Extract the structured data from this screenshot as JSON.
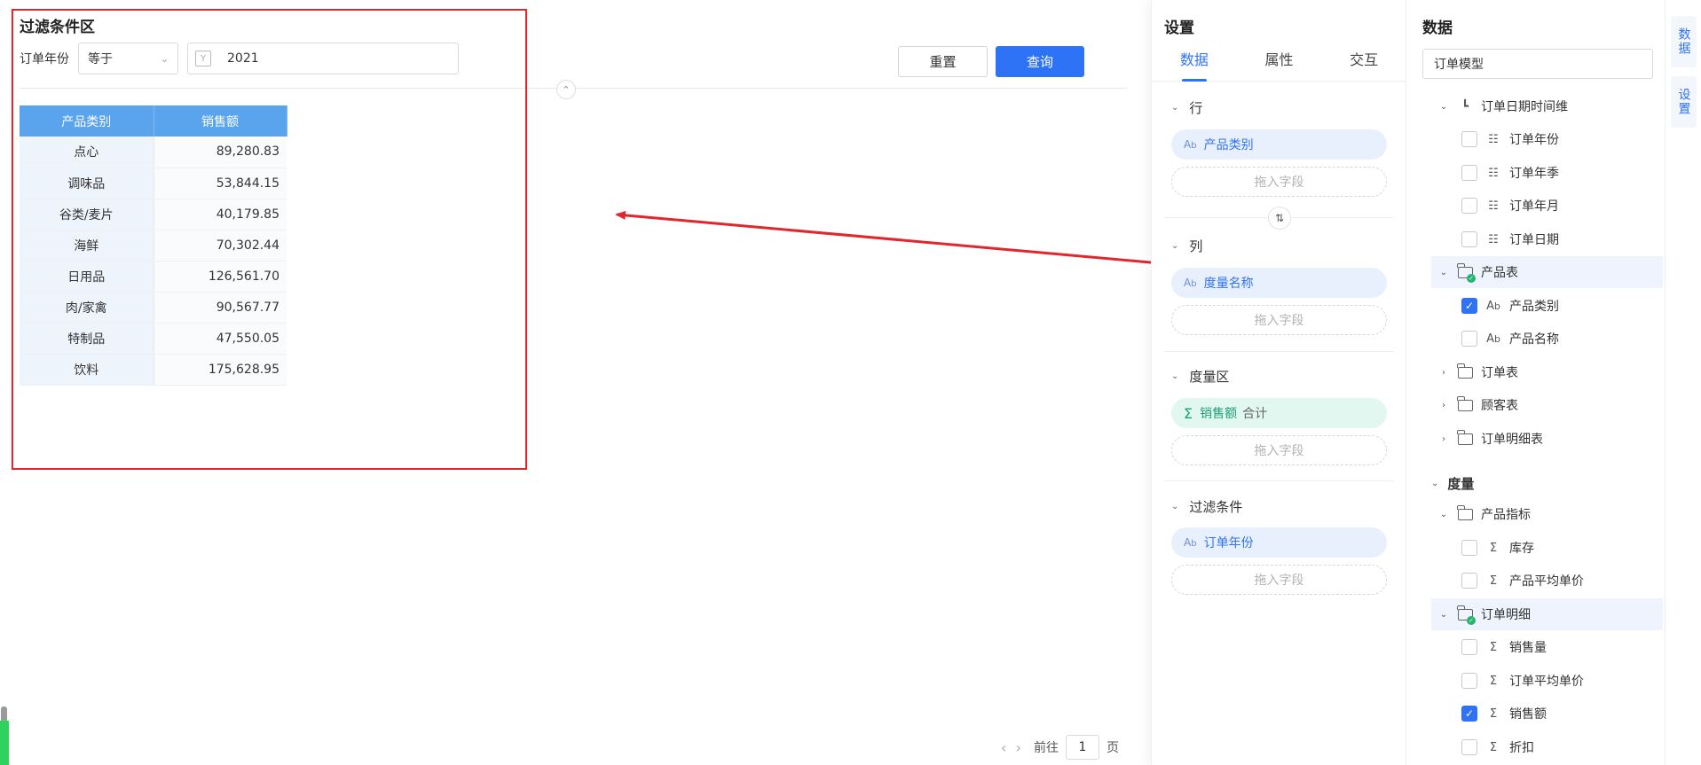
{
  "filter": {
    "title": "过滤条件区",
    "field_label": "订单年份",
    "operator": "等于",
    "value": "2021"
  },
  "buttons": {
    "reset": "重置",
    "query": "查询"
  },
  "table": {
    "headers": [
      "产品类别",
      "销售额"
    ],
    "rows": [
      {
        "category": "点心",
        "value": "89,280.83"
      },
      {
        "category": "调味品",
        "value": "53,844.15"
      },
      {
        "category": "谷类/麦片",
        "value": "40,179.85"
      },
      {
        "category": "海鲜",
        "value": "70,302.44"
      },
      {
        "category": "日用品",
        "value": "126,561.70"
      },
      {
        "category": "肉/家禽",
        "value": "90,567.77"
      },
      {
        "category": "特制品",
        "value": "47,550.05"
      },
      {
        "category": "饮料",
        "value": "175,628.95"
      }
    ]
  },
  "pager": {
    "goto_label": "前往",
    "page": "1",
    "page_suffix": "页"
  },
  "settings": {
    "title": "设置",
    "tabs": [
      "数据",
      "属性",
      "交互"
    ],
    "drop_hint": "拖入字段",
    "sections": {
      "row": {
        "label": "行",
        "field": "产品类别"
      },
      "column": {
        "label": "列",
        "field": "度量名称"
      },
      "measure": {
        "label": "度量区",
        "field": "销售额",
        "agg": "合计"
      },
      "filter": {
        "label": "过滤条件",
        "field": "订单年份"
      }
    }
  },
  "data_panel": {
    "title": "数据",
    "model": "订单模型",
    "dims": {
      "date_group": "订单日期时间维",
      "date_fields": [
        "订单年份",
        "订单年季",
        "订单年月",
        "订单日期"
      ],
      "product_table": "产品表",
      "product_fields": [
        "产品类别",
        "产品名称"
      ],
      "other_tables": [
        "订单表",
        "顾客表",
        "订单明细表"
      ]
    },
    "measures": {
      "label": "度量",
      "product_metrics": "产品指标",
      "product_metric_fields": [
        "库存",
        "产品平均单价"
      ],
      "order_detail": "订单明细",
      "order_detail_fields": [
        "销售量",
        "订单平均单价",
        "销售额",
        "折扣"
      ]
    }
  },
  "rail": {
    "data_tab": "数据",
    "settings_tab": "设置"
  },
  "colors": {
    "primary": "#2e73f5",
    "header_blue": "#5aa4ee",
    "annotation_red": "#e3262c",
    "measure_green": "#1a9f72"
  }
}
